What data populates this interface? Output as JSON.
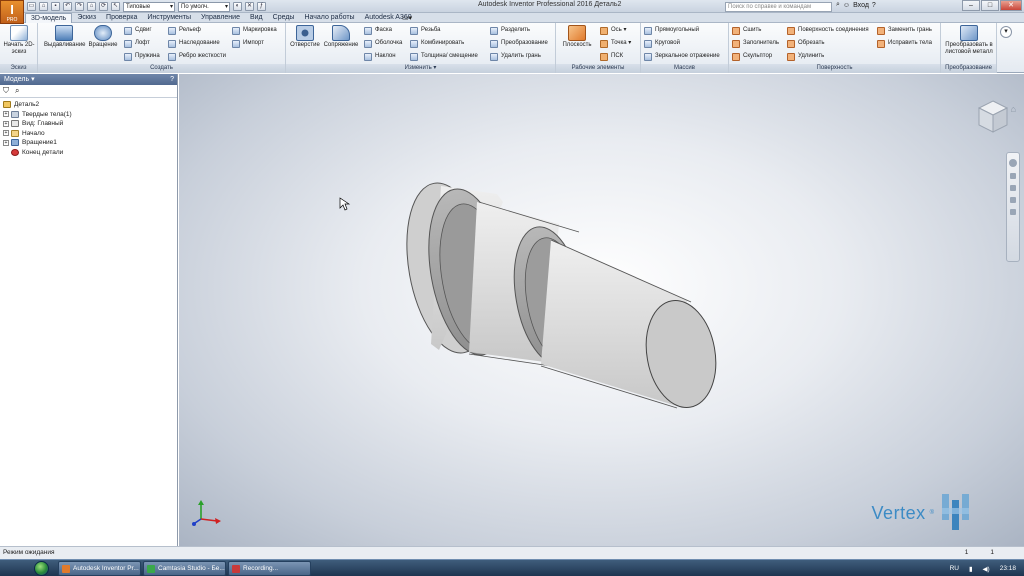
{
  "window": {
    "title": "Autodesk Inventor Professional 2016  Деталь2",
    "app_button_sub": "PRO"
  },
  "qat": {
    "style_dropdown": "Типовые",
    "material_dropdown": "По умолч."
  },
  "search": {
    "placeholder": "Поиск по справке и командам"
  },
  "user": {
    "name": "Вход"
  },
  "tabs": [
    "3D-модель",
    "Эскиз",
    "Проверка",
    "Инструменты",
    "Управление",
    "Вид",
    "Среды",
    "Начало работы",
    "Autodesk A360"
  ],
  "ribbon": {
    "sketch_panel": {
      "label": "Эскиз",
      "start_sketch": "Начать 2D-эскиз"
    },
    "create_panel": {
      "label": "Создать",
      "extrude": "Выдавливание",
      "revolve": "Вращение",
      "sweep": "Сдвиг",
      "loft": "Лофт",
      "coil": "Пружина",
      "emboss": "Рельеф",
      "derive": "Наследование",
      "rib": "Ребро жесткости",
      "mark": "Маркировка",
      "import": "Импорт"
    },
    "modify_panel": {
      "label": "Изменить ▾",
      "hole": "Отверстие",
      "fillet": "Сопряжение",
      "chamfer": "Фаска",
      "shell": "Оболочка",
      "draft": "Наклон",
      "thread": "Резьба",
      "combine": "Комбинировать",
      "thicken": "Толщина/ смещение",
      "split": "Разделить",
      "direct": "Преобразование",
      "delete_face": "Удалить грань"
    },
    "work_panel": {
      "label": "Рабочие элементы",
      "plane": "Плоскость",
      "axis": "Ось",
      "point": "Точка",
      "ucs": "ПСК"
    },
    "pattern_panel": {
      "label": "Массив",
      "rectangular": "Прямоугольный",
      "circular": "Круговой",
      "mirror": "Зеркальное отражение"
    },
    "surface_panel": {
      "label": "Поверхность",
      "stitch": "Сшить",
      "patch": "Заполнитель",
      "sculpt": "Скульптор",
      "ruled": "Поверхность соединения",
      "trim": "Обрезать",
      "extend": "Удлинить",
      "replace_face": "Заменить грань",
      "repair": "Исправить тела"
    },
    "convert_panel": {
      "label": "Преобразование",
      "convert": "Преобразовать в листовой металл"
    }
  },
  "browser": {
    "title": "Модель ▾",
    "tree": [
      {
        "label": "Деталь2",
        "level": 0
      },
      {
        "label": "Твердые тела(1)",
        "level": 1
      },
      {
        "label": "Вид: Главный",
        "level": 1
      },
      {
        "label": "Начало",
        "level": 1
      },
      {
        "label": "Вращение1",
        "level": 1
      },
      {
        "label": "Конец детали",
        "level": 1
      }
    ]
  },
  "viewcube": {
    "face": "ВЕРХ"
  },
  "watermark": {
    "text": "Vertex",
    "reg": "®"
  },
  "status": {
    "text": "Режим ожидания",
    "num1": "1",
    "num2": "1"
  },
  "taskbar": {
    "items": [
      "Autodesk Inventor Pr...",
      "Camtasia Studio - Бе...",
      "Recording..."
    ],
    "lang": "RU",
    "time": "23:18"
  }
}
